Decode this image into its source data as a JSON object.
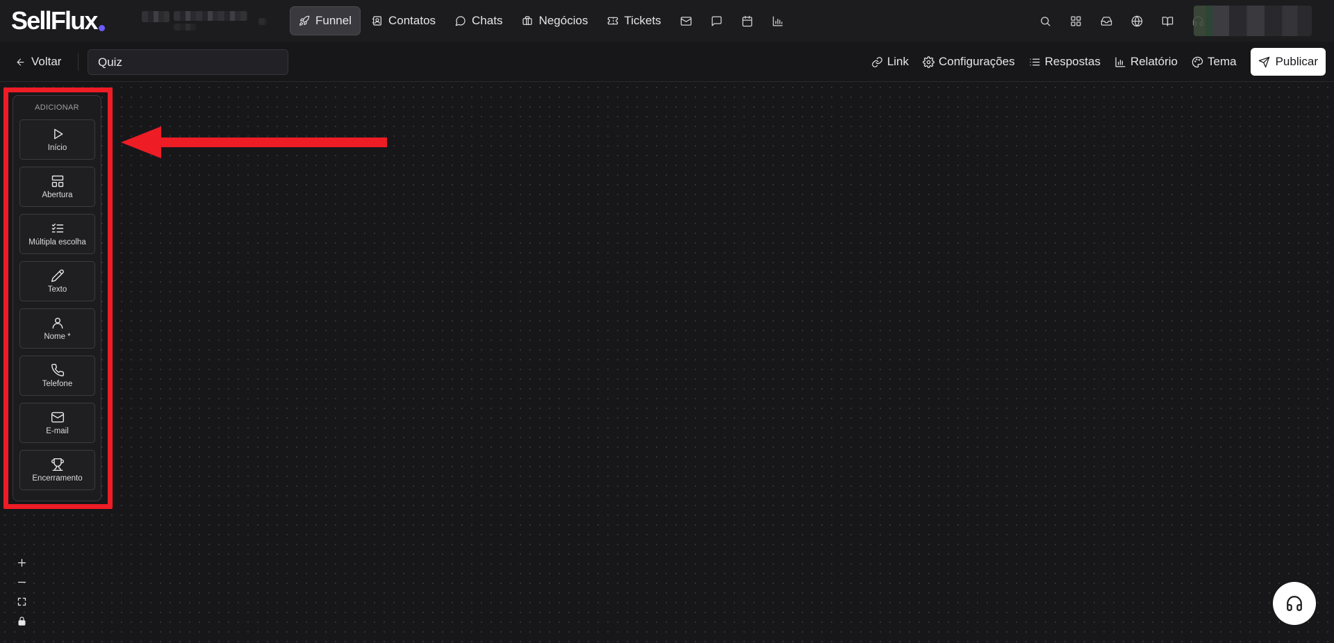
{
  "brand": {
    "logo_text": "SellFlux",
    "dot_color": "#6d5cff"
  },
  "topnav": {
    "tabs": [
      {
        "label": "Funnel",
        "icon": "rocket-icon",
        "active": true
      },
      {
        "label": "Contatos",
        "icon": "contacts-icon",
        "active": false
      },
      {
        "label": "Chats",
        "icon": "chat-bubble-icon",
        "active": false
      },
      {
        "label": "Negócios",
        "icon": "briefcase-icon",
        "active": false
      },
      {
        "label": "Tickets",
        "icon": "ticket-icon",
        "active": false
      }
    ],
    "extra_icons": [
      "mail-icon",
      "message-square-icon",
      "calendar-icon",
      "bar-chart-icon"
    ],
    "right_icons": [
      "search-icon",
      "apps-grid-icon",
      "inbox-icon",
      "globe-icon",
      "book-icon",
      "headset-icon"
    ]
  },
  "subbar": {
    "back_label": "Voltar",
    "title_value": "Quiz",
    "actions": [
      {
        "label": "Link",
        "icon": "link-icon"
      },
      {
        "label": "Configurações",
        "icon": "gear-icon"
      },
      {
        "label": "Respostas",
        "icon": "list-icon"
      },
      {
        "label": "Relatório",
        "icon": "bar-chart-icon"
      },
      {
        "label": "Tema",
        "icon": "palette-icon"
      }
    ],
    "publish_label": "Publicar"
  },
  "add_panel": {
    "title": "ADICIONAR",
    "items": [
      {
        "label": "Início",
        "icon": "play-icon"
      },
      {
        "label": "Abertura",
        "icon": "layout-icon"
      },
      {
        "label": "Múltipla escolha",
        "icon": "checklist-icon"
      },
      {
        "label": "Texto",
        "icon": "pencil-icon"
      },
      {
        "label": "Nome *",
        "icon": "user-icon"
      },
      {
        "label": "Telefone",
        "icon": "phone-icon"
      },
      {
        "label": "E-mail",
        "icon": "mail-icon"
      },
      {
        "label": "Encerramento",
        "icon": "trophy-icon"
      }
    ]
  },
  "annotation": {
    "highlight_color": "#ee1c25"
  },
  "zoom_controls": [
    "zoom-in-icon",
    "zoom-out-icon",
    "fit-view-icon",
    "lock-icon"
  ],
  "help_button": {
    "icon": "headset-icon"
  }
}
